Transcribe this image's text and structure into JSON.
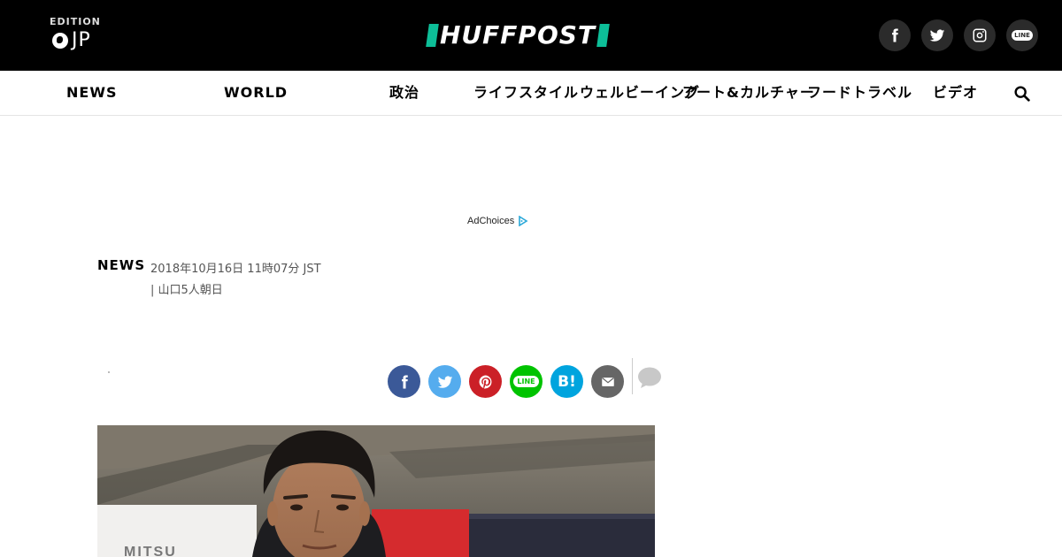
{
  "header": {
    "edition_label": "EDITION",
    "edition_code": "JP",
    "logo_text": "HUFFPOST",
    "brand_color": "#0dbe98",
    "social": [
      {
        "name": "facebook-icon"
      },
      {
        "name": "twitter-icon"
      },
      {
        "name": "instagram-icon"
      },
      {
        "name": "line-icon",
        "text": "LINE"
      }
    ]
  },
  "nav": {
    "items": [
      "NEWS",
      "WORLD",
      "政治",
      "ライフスタイル",
      "ウェルビーイング",
      "アート&カルチャー",
      "フードトラベル",
      "ビデオ"
    ],
    "search_icon": "search-icon"
  },
  "ad": {
    "adchoices_label": "AdChoices"
  },
  "article": {
    "section": "NEWS",
    "timestamp": "2018年10月16日 11時07分 JST",
    "author": "| 山口5人朝日"
  },
  "share": {
    "buttons": [
      {
        "name": "facebook-share",
        "color": "#3b5998"
      },
      {
        "name": "twitter-share",
        "color": "#55acee"
      },
      {
        "name": "pinterest-share",
        "color": "#cb2027"
      },
      {
        "name": "line-share",
        "color": "#00c300",
        "text": "LINE"
      },
      {
        "name": "hatena-share",
        "color": "#00a4de",
        "text": "B!"
      },
      {
        "name": "email-share",
        "color": "#666666"
      }
    ]
  }
}
